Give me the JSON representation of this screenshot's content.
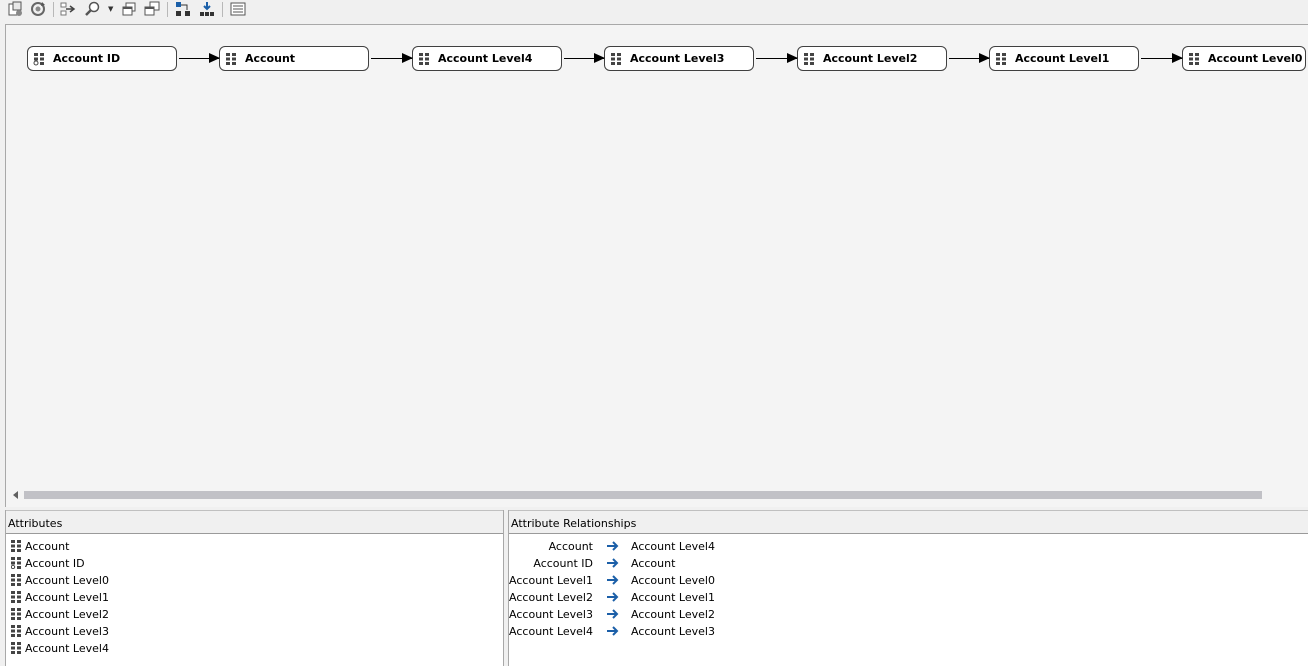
{
  "toolbar": {
    "buttons": [
      {
        "name": "new-attribute-relationship-icon"
      },
      {
        "name": "refresh-icon"
      },
      {
        "name": "connect-icon"
      },
      {
        "name": "zoom-icon"
      },
      {
        "name": "copy-icon"
      },
      {
        "name": "arrange-icon"
      },
      {
        "name": "layout-icon"
      },
      {
        "name": "download-icon"
      },
      {
        "name": "properties-icon"
      }
    ]
  },
  "diagram": {
    "nodes": [
      {
        "label": "Account ID",
        "icon": "key-attribute-icon"
      },
      {
        "label": "Account",
        "icon": "attribute-icon"
      },
      {
        "label": "Account Level4",
        "icon": "attribute-icon"
      },
      {
        "label": "Account Level3",
        "icon": "attribute-icon"
      },
      {
        "label": "Account Level2",
        "icon": "attribute-icon"
      },
      {
        "label": "Account Level1",
        "icon": "attribute-icon"
      },
      {
        "label": "Account Level0",
        "icon": "attribute-icon"
      }
    ]
  },
  "attributes": {
    "header": "Attributes",
    "items": [
      {
        "label": "Account",
        "icon": "attribute-icon"
      },
      {
        "label": "Account ID",
        "icon": "key-attribute-icon"
      },
      {
        "label": "Account Level0",
        "icon": "attribute-icon"
      },
      {
        "label": "Account Level1",
        "icon": "attribute-icon"
      },
      {
        "label": "Account Level2",
        "icon": "attribute-icon"
      },
      {
        "label": "Account Level3",
        "icon": "attribute-icon"
      },
      {
        "label": "Account Level4",
        "icon": "attribute-icon"
      }
    ]
  },
  "relationships": {
    "header": "Attribute Relationships",
    "items": [
      {
        "from": "Account",
        "to": "Account Level4"
      },
      {
        "from": "Account ID",
        "to": "Account"
      },
      {
        "from": "Account Level1",
        "to": "Account Level0"
      },
      {
        "from": "Account Level2",
        "to": "Account Level1"
      },
      {
        "from": "Account Level3",
        "to": "Account Level2"
      },
      {
        "from": "Account Level4",
        "to": "Account Level3"
      }
    ]
  },
  "colors": {
    "relationship_arrow": "#1b5fa8",
    "canvas_bg": "#f4f4f4",
    "scroll_thumb": "#c1c1c6"
  }
}
